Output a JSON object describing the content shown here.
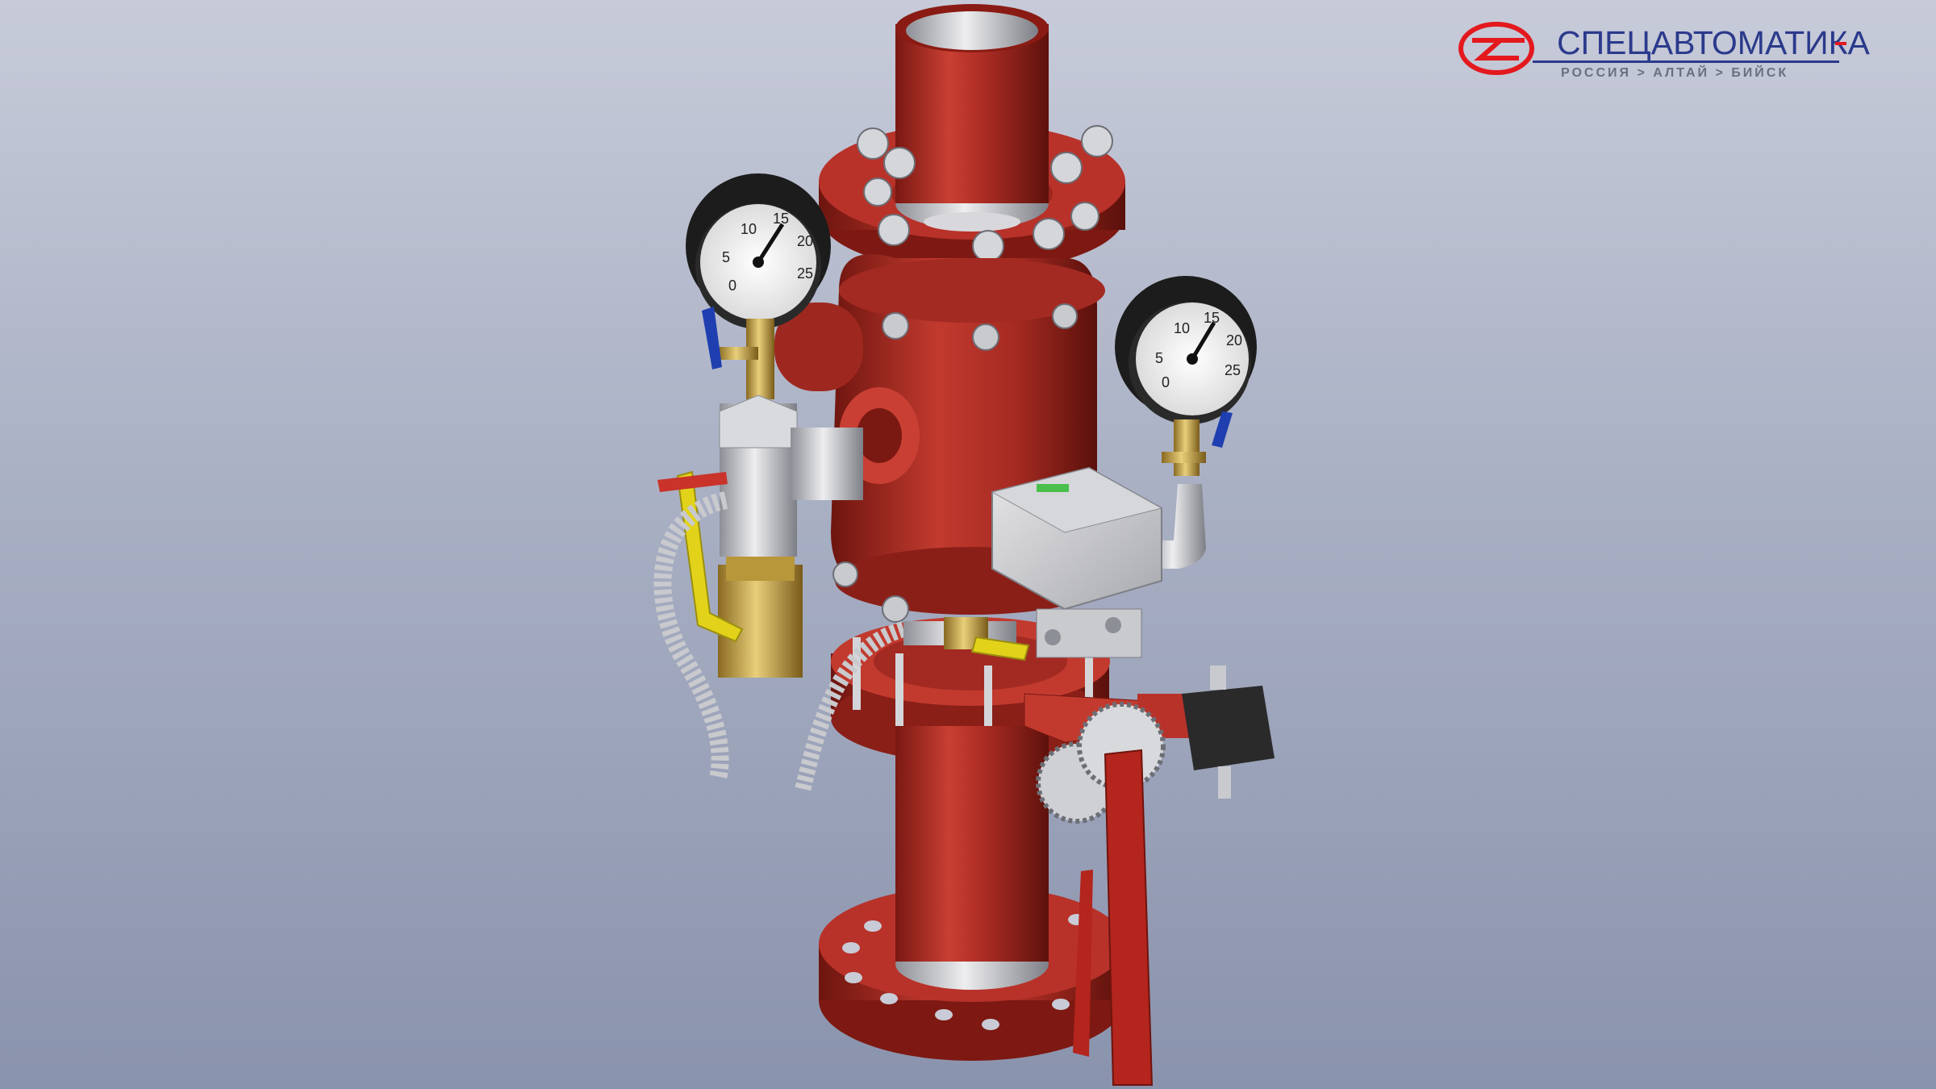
{
  "logo": {
    "name": "СПЕЦАВТОМАТИКА",
    "tagline": "РОССИЯ > АЛТАЙ > БИЙСК",
    "brand_color": "#2b3a8c",
    "accent_color": "#e3191e"
  },
  "gauges": {
    "left": {
      "ticks": [
        "0",
        "5",
        "10",
        "15",
        "20",
        "25"
      ]
    },
    "right": {
      "ticks": [
        "0",
        "5",
        "10",
        "15",
        "20",
        "25"
      ]
    }
  },
  "colors": {
    "valve_body": "#b8322a",
    "steel": "#c8c8cc",
    "brass": "#c9a548",
    "yellow_handle": "#e2d21a",
    "blue_handle": "#1f3fb0",
    "gauge_body": "#1c1c1c"
  }
}
